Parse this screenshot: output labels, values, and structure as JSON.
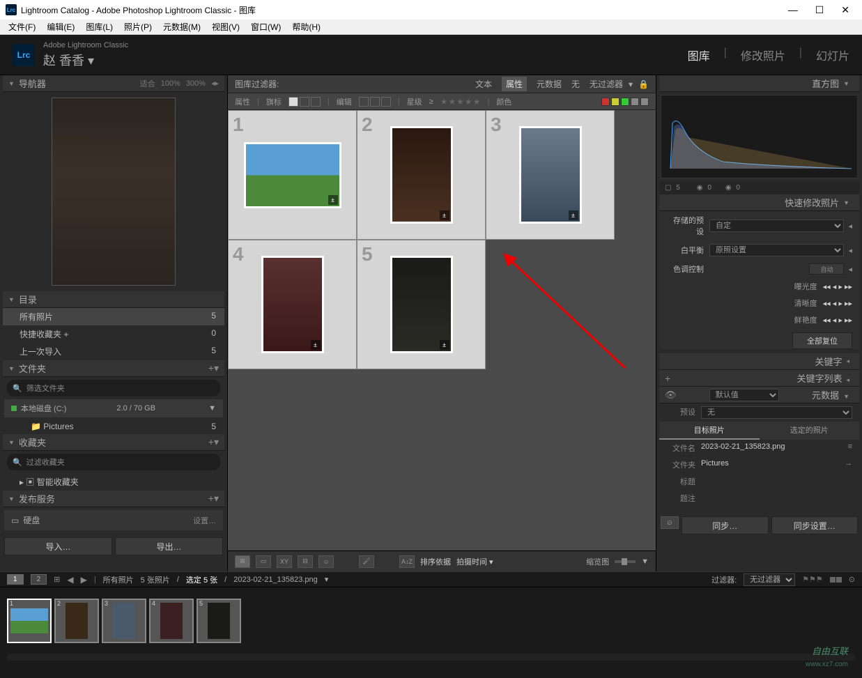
{
  "titlebar": {
    "text": "Lightroom Catalog - Adobe Photoshop Lightroom Classic - 图库",
    "logo": "Lrc"
  },
  "menu": [
    "文件(F)",
    "编辑(E)",
    "图库(L)",
    "照片(P)",
    "元数据(M)",
    "视图(V)",
    "窗口(W)",
    "帮助(H)"
  ],
  "topbar": {
    "subtitle": "Adobe Lightroom Classic",
    "user": "赵 香香",
    "modules": [
      "图库",
      "修改照片",
      "幻灯片"
    ]
  },
  "navigator": {
    "title": "导航器",
    "fit": "适合",
    "zoom1": "100%",
    "zoom2": "300%"
  },
  "catalog": {
    "title": "目录",
    "items": [
      {
        "label": "所有照片",
        "count": "5"
      },
      {
        "label": "快捷收藏夹 +",
        "count": "0"
      },
      {
        "label": "上一次导入",
        "count": "5"
      }
    ]
  },
  "folders": {
    "title": "文件夹",
    "search_placeholder": "筛选文件夹",
    "disk": "本地磁盘 (C:)",
    "disk_space": "2.0 / 70 GB",
    "folder_name": "Pictures",
    "folder_count": "5"
  },
  "collections": {
    "title": "收藏夹",
    "search_placeholder": "过滤收藏夹",
    "item": "智能收藏夹"
  },
  "publish": {
    "title": "发布服务",
    "hdd": "硬盘",
    "setup": "设置…"
  },
  "buttons": {
    "import": "导入…",
    "export": "导出…"
  },
  "filter": {
    "title": "图库过滤器:",
    "tabs": [
      "文本",
      "属性",
      "元数据",
      "无"
    ],
    "nofilter": "无过滤器"
  },
  "attr": {
    "label": "属性",
    "flags": "旗标",
    "edit": "编辑",
    "rating": "星级",
    "gte": "≥",
    "color": "颜色"
  },
  "grid": {
    "cells": [
      "1",
      "2",
      "3",
      "4",
      "5"
    ]
  },
  "toolbar": {
    "sort_label": "排序依据",
    "sort_value": "拍摄时间",
    "thumb_label": "缩览图"
  },
  "histogram": {
    "title": "直方图",
    "iso": "5",
    "aperture": "0",
    "shutter": "0"
  },
  "quickdev": {
    "title": "快速修改照片",
    "preset_label": "存储的预设",
    "preset_value": "自定",
    "wb_label": "白平衡",
    "wb_value": "原照设置",
    "tone_label": "色调控制",
    "auto": "自动",
    "exposure": "曝光度",
    "clarity": "清晰度",
    "vibrance": "鲜艳度",
    "reset": "全部复位"
  },
  "keywords": {
    "title": "关键字"
  },
  "keywordlist": {
    "title": "关键字列表"
  },
  "metadata": {
    "title": "元数据",
    "view": "默认值",
    "preset_label": "预设",
    "preset_value": "无",
    "tab1": "目标照片",
    "tab2": "选定的照片",
    "filename_label": "文件名",
    "filename_value": "2023-02-21_135823.png",
    "folder_label": "文件夹",
    "folder_value": "Pictures",
    "title_label": "标题",
    "caption_label": "题注"
  },
  "sync": {
    "sync": "同步…",
    "sync_settings": "同步设置…"
  },
  "filmstrip": {
    "path": "所有照片",
    "count": "5 张照片",
    "selected": "选定 5 张",
    "filename": "2023-02-21_135823.png",
    "filter_label": "过滤器:",
    "filter_value": "无过滤器"
  },
  "watermark": {
    "line1": "自由互联",
    "line2": "www.xz7.com"
  }
}
